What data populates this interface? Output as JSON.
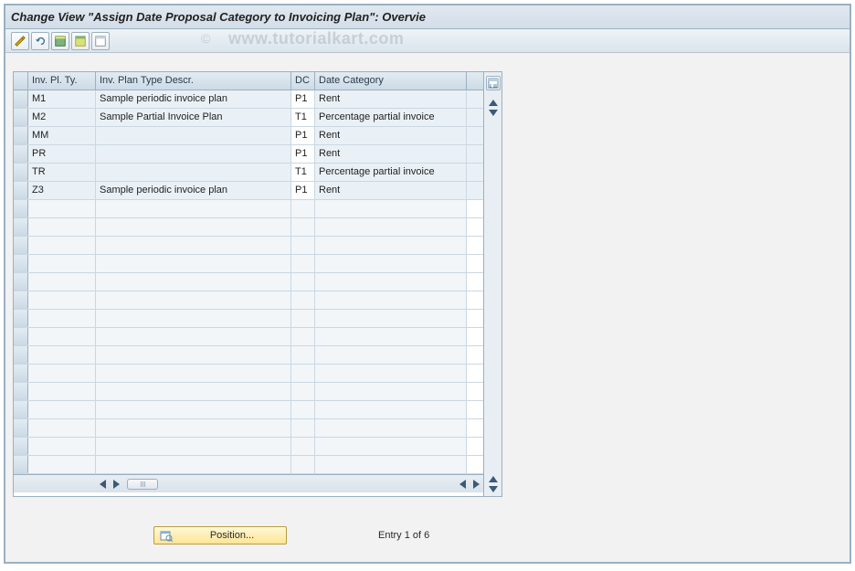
{
  "title": "Change View \"Assign Date Proposal Category to Invoicing Plan\": Overvie",
  "watermark": "www.tutorialkart.com",
  "copyright_mark": "©",
  "columns": {
    "c0": "Inv. Pl. Ty.",
    "c1": "Inv. Plan Type Descr.",
    "c2": "DC",
    "c3": "Date Category"
  },
  "rows": [
    {
      "c0": "M1",
      "c1": "Sample periodic invoice plan",
      "c2": "P1",
      "c3": "Rent"
    },
    {
      "c0": "M2",
      "c1": "Sample Partial Invoice Plan",
      "c2": "T1",
      "c3": "Percentage partial invoice"
    },
    {
      "c0": "MM",
      "c1": "",
      "c2": "P1",
      "c3": "Rent"
    },
    {
      "c0": "PR",
      "c1": "",
      "c2": "P1",
      "c3": "Rent"
    },
    {
      "c0": "TR",
      "c1": "",
      "c2": "T1",
      "c3": "Percentage partial invoice"
    },
    {
      "c0": "Z3",
      "c1": "Sample periodic invoice plan",
      "c2": "P1",
      "c3": "Rent"
    }
  ],
  "empty_row_count": 15,
  "position_button_label": "Position...",
  "entry_label": "Entry 1 of 6",
  "toolbar_icons": [
    "display-change-icon",
    "undo-icon",
    "select-all-icon",
    "select-block-icon",
    "deselect-all-icon"
  ]
}
